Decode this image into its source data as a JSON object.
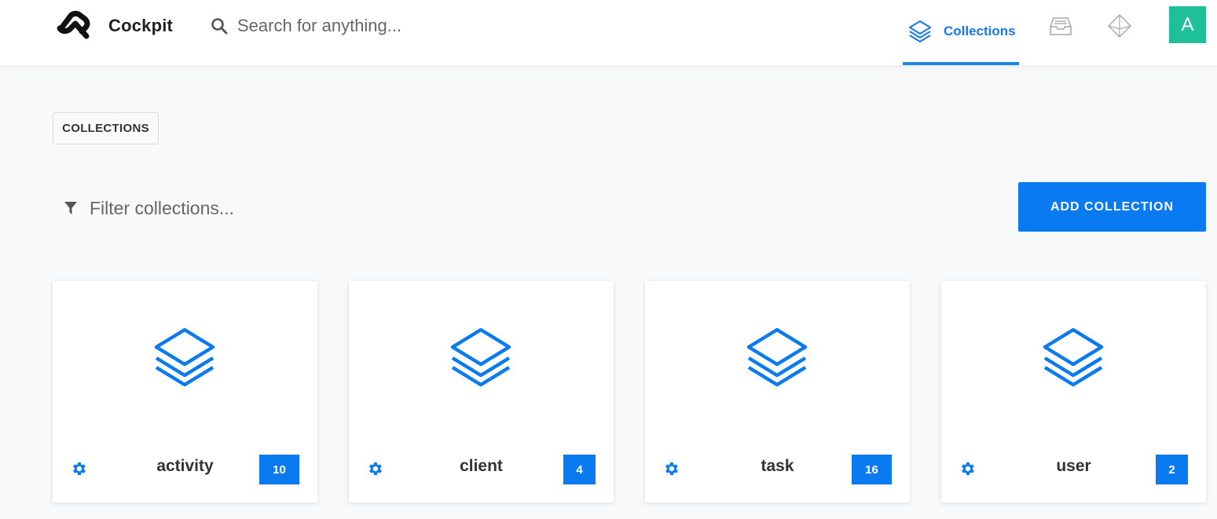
{
  "header": {
    "brand": "Cockpit",
    "search_placeholder": "Search for anything...",
    "nav_active_label": "Collections",
    "avatar_initial": "A",
    "accent_color": "#1e88e5",
    "avatar_color": "#1fbf99"
  },
  "page": {
    "breadcrumb": "COLLECTIONS",
    "filter_placeholder": "Filter collections...",
    "add_button": "ADD COLLECTION"
  },
  "collections": [
    {
      "name": "activity",
      "count": "10",
      "icon": "layers-icon"
    },
    {
      "name": "client",
      "count": "4",
      "icon": "layers-icon"
    },
    {
      "name": "task",
      "count": "16",
      "icon": "layers-icon"
    },
    {
      "name": "user",
      "count": "2",
      "icon": "layers-icon"
    }
  ]
}
